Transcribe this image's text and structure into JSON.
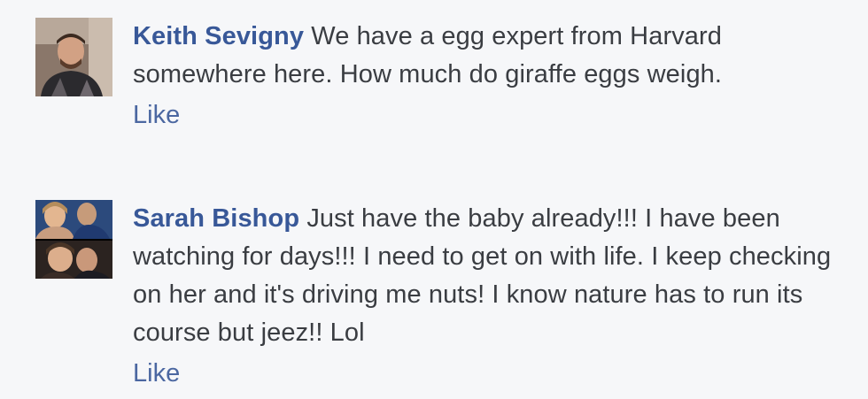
{
  "comments": [
    {
      "author": "Keith Sevigny",
      "message": "We have a egg expert from Harvard somewhere here. How much do giraffe eggs weigh.",
      "like_label": "Like",
      "avatar_icon": "profile-photo"
    },
    {
      "author": "Sarah Bishop",
      "message": "Just have the baby already!!! I have been watching for days!!! I need to get on with life. I keep checking on her and it's driving me nuts! I know nature has to run its course but jeez!! Lol",
      "like_label": "Like",
      "avatar_icon": "profile-photo"
    }
  ],
  "colors": {
    "background": "#f6f7f9",
    "author_link": "#385898",
    "like_link": "#4b67a1",
    "text": "#3a3d42"
  }
}
